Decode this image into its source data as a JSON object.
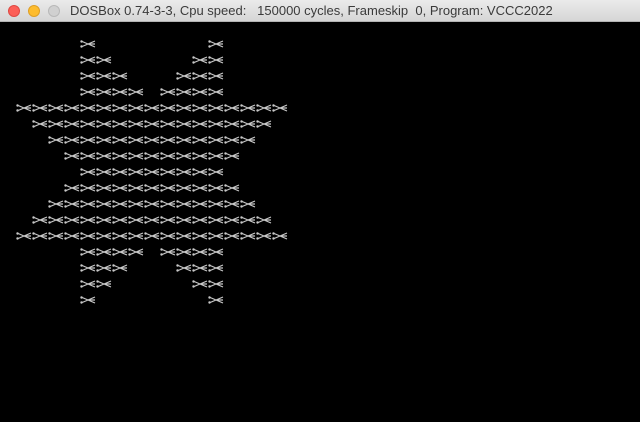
{
  "window": {
    "title": "DOSBox 0.74-3-3, Cpu speed:   150000 cycles, Frameskip  0, Program: VCCC2022",
    "controls": {
      "close": "close-button",
      "minimize": "minimize-button",
      "zoom": "zoom-button"
    }
  },
  "screen": {
    "background": "#000000",
    "glyph_color": "#c8c8c8",
    "glyph_icon": "scissors-glyph-icon",
    "pattern_rows": [
      "    *       *    ",
      "    **     **    ",
      "    ***   ***    ",
      "    **** ****    ",
      "*****************",
      " *************** ",
      "  *************  ",
      "   ***********   ",
      "    *********    ",
      "   ***********   ",
      "  *************  ",
      " *************** ",
      "*****************",
      "    **** ****    ",
      "    ***   ***    ",
      "    **     **    ",
      "    *       *    "
    ]
  }
}
